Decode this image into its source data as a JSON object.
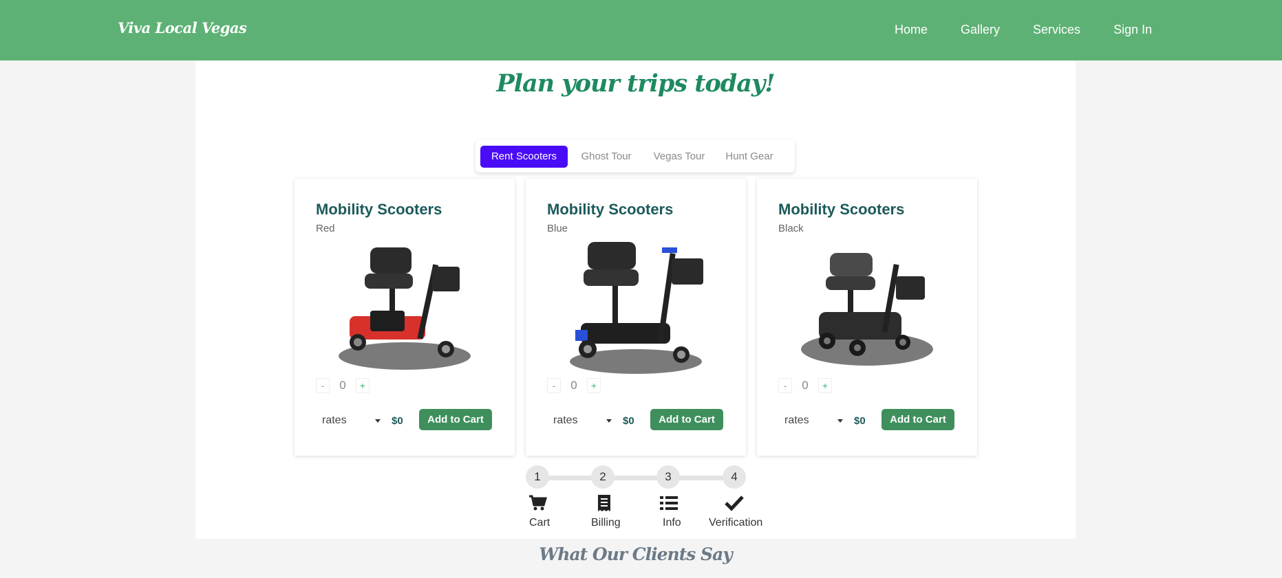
{
  "nav": {
    "brand": "Viva Local Vegas",
    "links": [
      "Home",
      "Gallery",
      "Services",
      "Sign In"
    ]
  },
  "page": {
    "title": "Plan your trips today!"
  },
  "tabs": [
    {
      "label": "Rent Scooters",
      "active": true
    },
    {
      "label": "Ghost Tour",
      "active": false
    },
    {
      "label": "Vegas Tour",
      "active": false
    },
    {
      "label": "Hunt Gear",
      "active": false
    }
  ],
  "products": [
    {
      "title": "Mobility Scooters",
      "color": "Red",
      "accent": "#d8312b",
      "qty": "0",
      "rates_label": "rates",
      "price": "$0",
      "add_label": "Add to Cart"
    },
    {
      "title": "Mobility Scooters",
      "color": "Blue",
      "accent": "#2a4fd8",
      "qty": "0",
      "rates_label": "rates",
      "price": "$0",
      "add_label": "Add to Cart"
    },
    {
      "title": "Mobility Scooters",
      "color": "Black",
      "accent": "#3a3a3a",
      "qty": "0",
      "rates_label": "rates",
      "price": "$0",
      "add_label": "Add to Cart"
    }
  ],
  "qty_controls": {
    "minus": "-",
    "plus": "+"
  },
  "steps": [
    {
      "num": "1",
      "label": "Cart",
      "icon": "cart-icon"
    },
    {
      "num": "2",
      "label": "Billing",
      "icon": "receipt-icon"
    },
    {
      "num": "3",
      "label": "Info",
      "icon": "list-icon"
    },
    {
      "num": "4",
      "label": "Verification",
      "icon": "check-icon"
    }
  ],
  "testimonials": {
    "title": "What Our Clients Say"
  },
  "colors": {
    "navbar": "#5db174",
    "tab_active": "#4a0cf7",
    "title": "#1e8a5f",
    "button": "#3f8f5c"
  }
}
